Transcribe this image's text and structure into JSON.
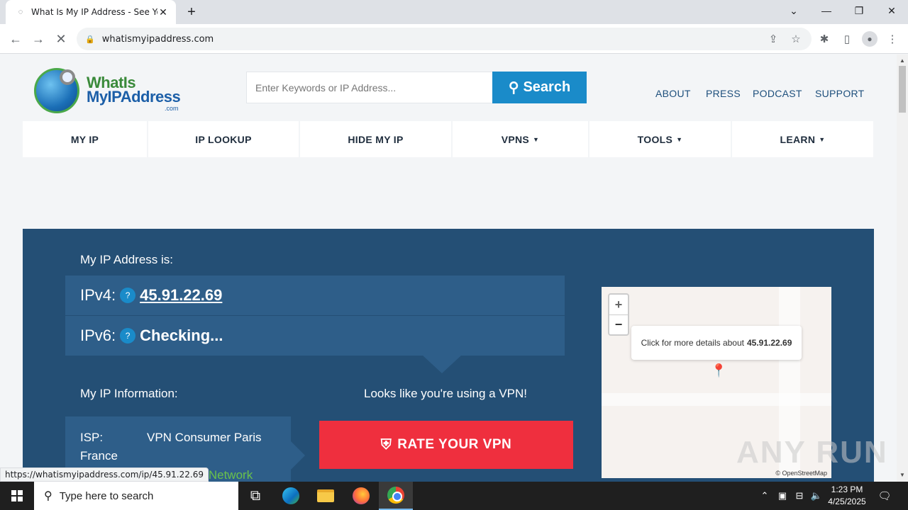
{
  "browser": {
    "tab_title": "What Is My IP Address - See You",
    "url": "whatismyipaddress.com",
    "status_url": "https://whatismyipaddress.com/ip/45.91.22.69"
  },
  "site": {
    "logo": {
      "line1": "WhatIs",
      "line2": "MyIPAddress",
      "line3": ".com"
    },
    "search_placeholder": "Enter Keywords or IP Address...",
    "search_button": "Search",
    "top_links": [
      "ABOUT",
      "PRESS",
      "PODCAST",
      "SUPPORT"
    ],
    "nav": [
      {
        "label": "MY IP",
        "caret": ""
      },
      {
        "label": "IP LOOKUP",
        "caret": ""
      },
      {
        "label": "HIDE MY IP",
        "caret": ""
      },
      {
        "label": "VPNS",
        "caret": "▼"
      },
      {
        "label": "TOOLS",
        "caret": "▼"
      },
      {
        "label": "LEARN",
        "caret": "▼"
      }
    ]
  },
  "hero": {
    "ip_heading": "My IP Address is:",
    "ipv4_label": "IPv4:",
    "ipv4_value": "45.91.22.69",
    "ipv6_label": "IPv6:",
    "ipv6_value": "Checking...",
    "help_glyph": "?",
    "info_heading": "My IP Information:",
    "isp_label": "ISP:",
    "isp_value": "VPN Consumer Paris",
    "isp_value2": "France",
    "protected_text": "cted Network",
    "vpn_message": "Looks like you're using a VPN!",
    "rate_button": "RATE YOUR VPN"
  },
  "map": {
    "zoom_in": "+",
    "zoom_out": "−",
    "popup_text": "Click for more details about",
    "popup_ip": "45.91.22.69",
    "attribution": "© OpenStreetMap"
  },
  "watermark": "ANY RUN",
  "taskbar": {
    "search_placeholder": "Type here to search",
    "time": "1:23 PM",
    "date": "4/25/2025"
  },
  "colors": {
    "hero_bg": "#244f75",
    "search_blue": "#1a8bc9",
    "rate_red": "#ef2f3e",
    "protected_green": "#6ac14b"
  }
}
